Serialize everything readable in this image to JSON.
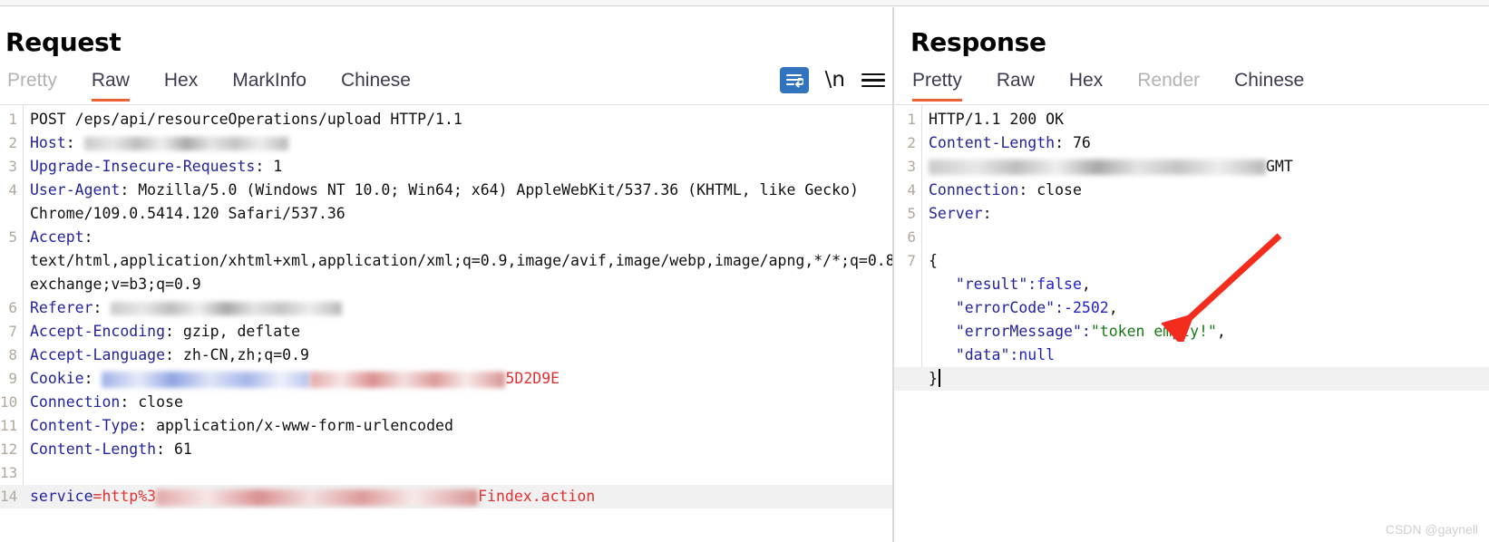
{
  "request": {
    "title": "Request",
    "tabs": [
      {
        "label": "Pretty",
        "state": "disabled"
      },
      {
        "label": "Raw",
        "state": "active"
      },
      {
        "label": "Hex",
        "state": "normal"
      },
      {
        "label": "MarkInfo",
        "state": "normal"
      },
      {
        "label": "Chinese",
        "state": "normal"
      }
    ],
    "toolbar": {
      "wrap_icon": "word-wrap-icon",
      "newline_label": "\\n",
      "menu_icon": "hamburger-menu-icon"
    },
    "lines": [
      {
        "n": "1",
        "pre": "",
        "text": "POST /eps/api/resourceOperations/upload HTTP/1.1"
      },
      {
        "n": "2",
        "pre": "Host",
        "text": ": ",
        "redacted": "grey"
      },
      {
        "n": "3",
        "pre": "Upgrade-Insecure-Requests",
        "text": ": 1"
      },
      {
        "n": "4",
        "pre": "User-Agent",
        "text": ": Mozilla/5.0 (Windows NT 10.0; Win64; x64) AppleWebKit/537.36 (KHTML, like Gecko) Chrome/109.0.5414.120 Safari/537.36"
      },
      {
        "n": "5",
        "pre": "Accept",
        "text": ": text/html,application/xhtml+xml,application/xml;q=0.9,image/avif,image/webp,image/apng,*/*;q=0.8,application/signed-exchange;v=b3;q=0.9"
      },
      {
        "n": "6",
        "pre": "Referer",
        "text": ": ",
        "redacted": "grey"
      },
      {
        "n": "7",
        "pre": "Accept-Encoding",
        "text": ": gzip, deflate"
      },
      {
        "n": "8",
        "pre": "Accept-Language",
        "text": ": zh-CN,zh;q=0.9"
      },
      {
        "n": "9",
        "pre": "Cookie",
        "text": ": ",
        "redacted": "cookie",
        "tail": "5D2D9E"
      },
      {
        "n": "10",
        "pre": "Connection",
        "text": ": close"
      },
      {
        "n": "11",
        "pre": "Content-Type",
        "text": ": application/x-www-form-urlencoded"
      },
      {
        "n": "12",
        "pre": "Content-Length",
        "text": ": 61"
      },
      {
        "n": "13",
        "pre": "",
        "text": ""
      },
      {
        "n": "14",
        "pre": "service",
        "text": "=http%3",
        "redacted": "body",
        "tail": "Findex.action",
        "highlight": true
      }
    ]
  },
  "response": {
    "title": "Response",
    "tabs": [
      {
        "label": "Pretty",
        "state": "active"
      },
      {
        "label": "Raw",
        "state": "normal"
      },
      {
        "label": "Hex",
        "state": "normal"
      },
      {
        "label": "Render",
        "state": "disabled"
      },
      {
        "label": "Chinese",
        "state": "normal"
      }
    ],
    "lines": [
      {
        "n": "1",
        "status": "HTTP/1.1 200 OK"
      },
      {
        "n": "2",
        "hdr": "Content-Length",
        "val": ": 76"
      },
      {
        "n": "3",
        "redacted": "grey",
        "tail": "GMT"
      },
      {
        "n": "4",
        "hdr": "Connection",
        "val": ": close"
      },
      {
        "n": "5",
        "hdr": "Server",
        "val": ":"
      },
      {
        "n": "6",
        "blank": true
      },
      {
        "n": "7",
        "brace": "{"
      }
    ],
    "json_body": [
      {
        "indent": 1,
        "key": "\"result\"",
        "sep": ":",
        "value": "false",
        "type": "literal",
        "comma": ","
      },
      {
        "indent": 1,
        "key": "\"errorCode\"",
        "sep": ":",
        "value": "-2502",
        "type": "number",
        "comma": ","
      },
      {
        "indent": 1,
        "key": "\"errorMessage\"",
        "sep": ":",
        "value": "\"token empty!\"",
        "type": "string",
        "comma": ","
      },
      {
        "indent": 1,
        "key": "\"data\"",
        "sep": ":",
        "value": "null",
        "type": "literal",
        "comma": ""
      },
      {
        "indent": 0,
        "close": "}",
        "cursor": true,
        "highlight": true
      }
    ]
  },
  "annotation": {
    "arrow_color": "#f42c1e",
    "arrow_target": "errorMessage-value"
  },
  "watermark": "CSDN @gaynell",
  "colors": {
    "accent": "#ef6034",
    "header_name": "#23239c",
    "string_value": "#167a16",
    "number_value": "#2222cc",
    "cookie_tail": "#e03030",
    "wrap_button": "#3273c0"
  }
}
